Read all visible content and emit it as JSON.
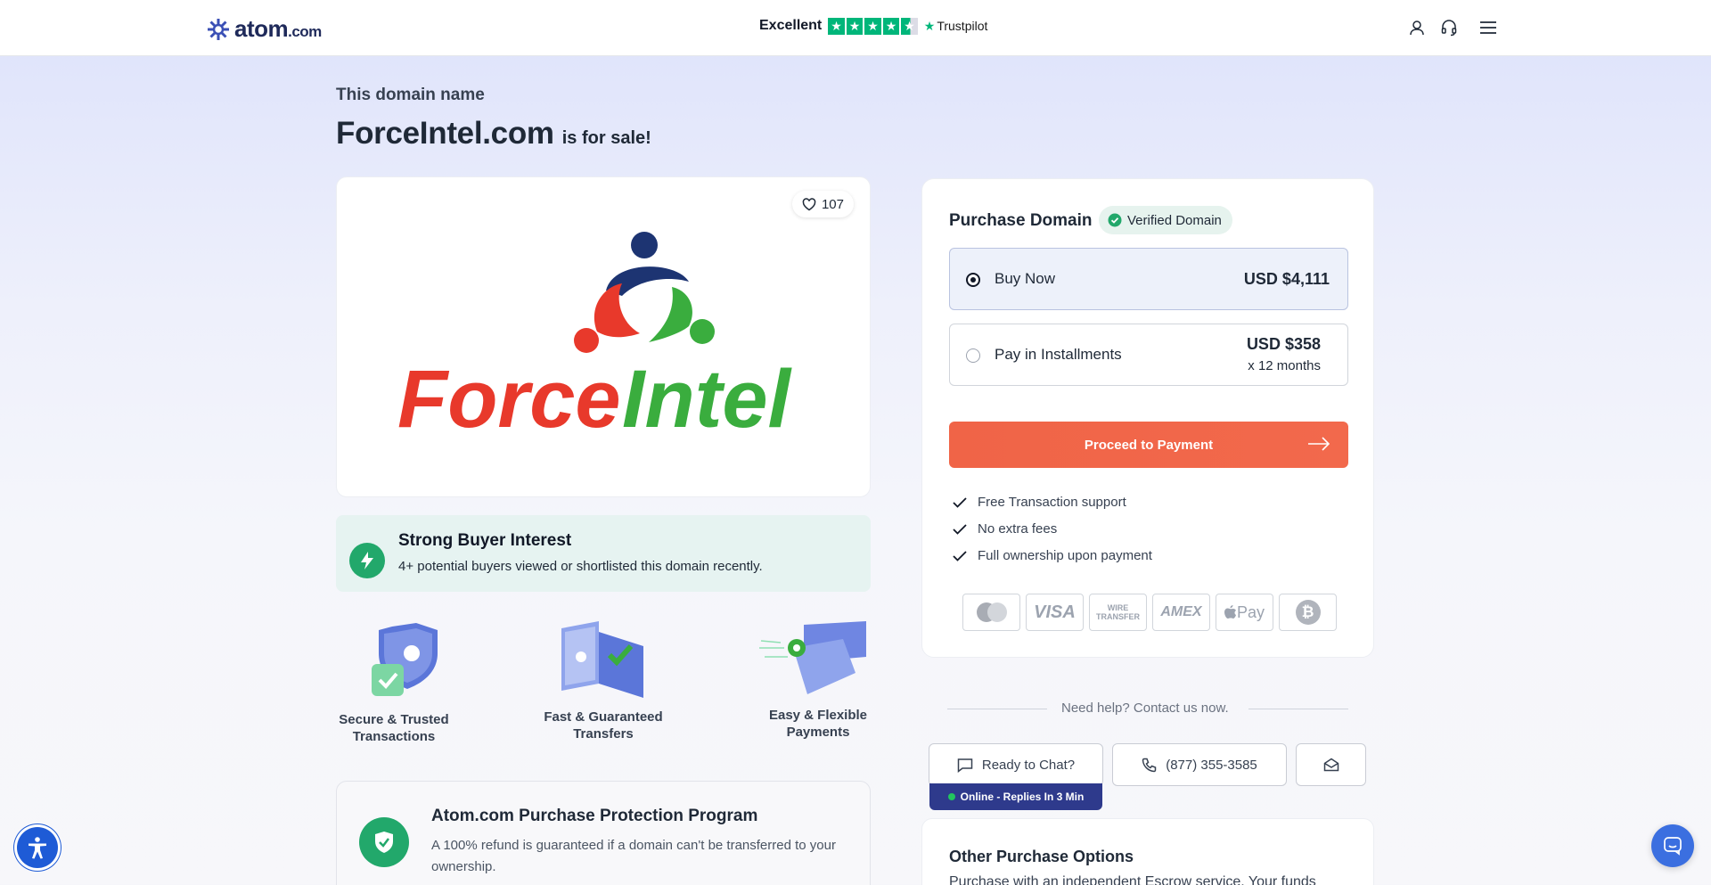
{
  "header": {
    "logo_text": "atom",
    "logo_suffix": ".com",
    "trust_label": "Excellent",
    "trust_brand": "Trustpilot",
    "icons": [
      "user-icon",
      "headset-icon",
      "menu-icon"
    ]
  },
  "hero": {
    "subtitle": "This domain name",
    "domain": "ForceIntel.com",
    "for_sale": "is for sale!"
  },
  "logo_card": {
    "likes": "107",
    "brand_text": "ForceIntel",
    "brand_colors": {
      "red": "#e8392b",
      "green": "#3aad3e",
      "navy": "#1d3472"
    }
  },
  "interest": {
    "title": "Strong Buyer Interest",
    "description": "4+ potential buyers viewed or shortlisted this domain recently."
  },
  "features": [
    {
      "line1": "Secure & Trusted",
      "line2": "Transactions"
    },
    {
      "line1": "Fast & Guaranteed",
      "line2": "Transfers"
    },
    {
      "line1": "Easy & Flexible",
      "line2": "Payments"
    }
  ],
  "protection": {
    "title": "Atom.com Purchase Protection Program",
    "description": "A 100% refund is guaranteed if a domain can't be transferred to your ownership."
  },
  "purchase": {
    "title": "Purchase Domain",
    "verified": "Verified Domain",
    "options": [
      {
        "label": "Buy Now",
        "price": "USD $4,111",
        "selected": true
      },
      {
        "label": "Pay in Installments",
        "price": "USD $358",
        "sub": "x 12 months",
        "selected": false
      }
    ],
    "proceed": "Proceed to Payment",
    "perks": [
      "Free Transaction support",
      "No extra fees",
      "Full ownership upon payment"
    ],
    "payment_methods": [
      "mastercard-icon",
      "visa-icon",
      "wire-transfer-icon",
      "amex-icon",
      "apple-pay-icon",
      "bitcoin-icon"
    ],
    "payment_labels": {
      "visa": "VISA",
      "wire1": "WIRE",
      "wire2": "TRANSFER",
      "amex": "AMEX",
      "apple": "Pay",
      "btc": "₿"
    }
  },
  "help": {
    "text": "Need help? Contact us now.",
    "chat": "Ready to Chat?",
    "phone": "(877) 355-3585",
    "online": "Online - Replies In 3 Min"
  },
  "other": {
    "title": "Other Purchase Options",
    "description": "Purchase with an independent Escrow service. Your funds"
  },
  "colors": {
    "accent": "#f06447",
    "green": "#22a86b",
    "navy": "#2e3a8c"
  }
}
